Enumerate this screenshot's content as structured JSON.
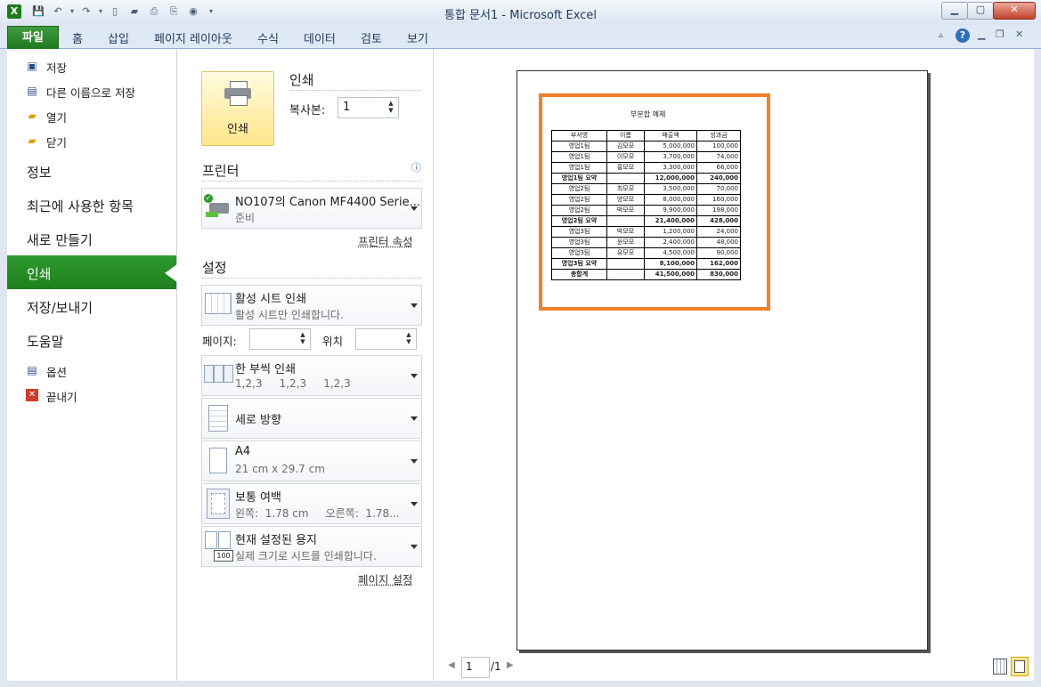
{
  "window": {
    "title": "통합 문서1 - Microsoft Excel",
    "app_icon": "excel-icon",
    "controls": {
      "minimize": "▁",
      "restore": "▢",
      "close": "✕"
    }
  },
  "ribbon": {
    "file_tab": "파일",
    "tabs": [
      "홈",
      "삽입",
      "페이지 레이아웃",
      "수식",
      "데이터",
      "검토",
      "보기"
    ],
    "help_icon": "?"
  },
  "nav": {
    "small_top": [
      {
        "label": "저장",
        "icon": "save-icon"
      },
      {
        "label": "다른 이름으로 저장",
        "icon": "save-as-icon"
      },
      {
        "label": "열기",
        "icon": "folder-open-icon"
      },
      {
        "label": "닫기",
        "icon": "folder-close-icon"
      }
    ],
    "big": [
      "정보",
      "최근에 사용한 항목",
      "새로 만들기",
      "인쇄",
      "저장/보내기",
      "도움말"
    ],
    "small_bottom": [
      {
        "label": "옵션",
        "icon": "options-icon"
      },
      {
        "label": "끝내기",
        "icon": "exit-icon"
      }
    ],
    "selected": "인쇄"
  },
  "print": {
    "section_title": "인쇄",
    "button_label": "인쇄",
    "copies_label": "복사본:",
    "copies_value": "1",
    "printer_section": "프린터",
    "info_icon": "ⓘ",
    "printer_name": "NO107의 Canon MF4400 Serie...",
    "printer_status": "준비",
    "printer_props_link": "프린터 속성",
    "settings_section": "설정",
    "settings": [
      {
        "main": "활성 시트 인쇄",
        "sub": "활성 시트만 인쇄합니다.",
        "icon": "sheet-icon"
      },
      {
        "main": "한 부씩 인쇄",
        "sub": "1,2,3     1,2,3     1,2,3",
        "icon": "collate-icon"
      },
      {
        "main": "세로 방향",
        "sub": "",
        "icon": "portrait-icon"
      },
      {
        "main": "A4",
        "sub": "21 cm x 29.7 cm",
        "icon": "paper-icon"
      },
      {
        "main": "보통 여백",
        "sub": "왼쪽:  1.78 cm     오른쪽:  1.78...",
        "icon": "margins-icon"
      },
      {
        "main": "현재 설정된 용지",
        "sub": "실제 크기로 시트를 인쇄합니다.",
        "icon": "scaling-icon"
      }
    ],
    "pages_label": "페이지:",
    "pages_to_label": "위치",
    "page_setup_link": "페이지 설정"
  },
  "preview": {
    "sheet_title": "부분합 예제",
    "headers": [
      "부서명",
      "이름",
      "매출액",
      "성과금"
    ],
    "rows": [
      {
        "dept": "영업1팀",
        "name": "김모모",
        "sales": "5,000,000",
        "bonus": "100,000",
        "bold": false
      },
      {
        "dept": "영업1팀",
        "name": "이모모",
        "sales": "3,700,000",
        "bonus": "74,000",
        "bold": false
      },
      {
        "dept": "영업1팀",
        "name": "홍모모",
        "sales": "3,300,000",
        "bonus": "66,000",
        "bold": false
      },
      {
        "dept": "영업1팀 요약",
        "name": "",
        "sales": "12,000,000",
        "bonus": "240,000",
        "bold": true
      },
      {
        "dept": "영업2팀",
        "name": "최모모",
        "sales": "3,500,000",
        "bonus": "70,000",
        "bold": false
      },
      {
        "dept": "영업2팀",
        "name": "양모모",
        "sales": "8,000,000",
        "bonus": "160,000",
        "bold": false
      },
      {
        "dept": "영업2팀",
        "name": "박모모",
        "sales": "9,900,000",
        "bonus": "198,000",
        "bold": false
      },
      {
        "dept": "영업2팀 요약",
        "name": "",
        "sales": "21,400,000",
        "bonus": "428,000",
        "bold": true
      },
      {
        "dept": "영업3팀",
        "name": "박모모",
        "sales": "1,200,000",
        "bonus": "24,000",
        "bold": false
      },
      {
        "dept": "영업3팀",
        "name": "윤모모",
        "sales": "2,400,000",
        "bonus": "48,000",
        "bold": false
      },
      {
        "dept": "영업3팀",
        "name": "유모모",
        "sales": "4,500,000",
        "bonus": "90,000",
        "bold": false
      },
      {
        "dept": "영업3팀 요약",
        "name": "",
        "sales": "8,100,000",
        "bonus": "162,000",
        "bold": true
      },
      {
        "dept": "총합계",
        "name": "",
        "sales": "41,500,000",
        "bonus": "830,000",
        "bold": true
      }
    ],
    "page_current": "1",
    "page_total": "/1",
    "prev_icon": "◀",
    "next_icon": "▶"
  },
  "colors": {
    "accent": "#2e9a2e",
    "highlight": "#f07f29"
  }
}
